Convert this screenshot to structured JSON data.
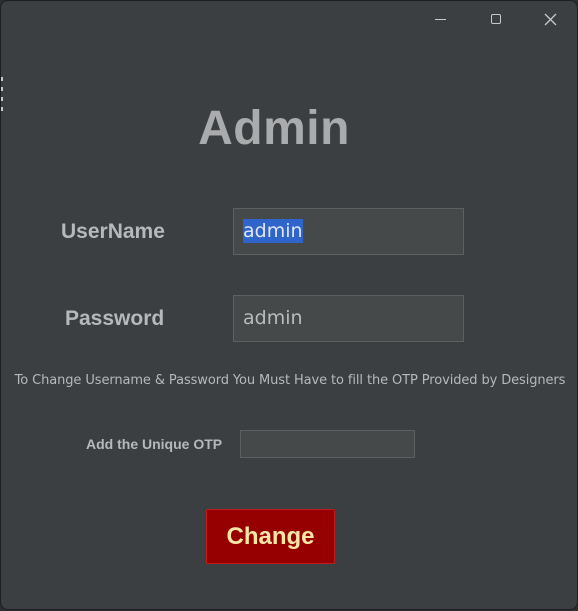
{
  "window": {
    "controls": {
      "minimize": "minimize-icon",
      "maximize": "maximize-icon",
      "close": "close-icon"
    }
  },
  "form": {
    "title": "Admin",
    "username_label": "UserName",
    "username_value": "admin",
    "password_label": "Password",
    "password_value": "admin",
    "notice": "To Change Username & Password You Must Have to fill the OTP Provided by Designers",
    "otp_label": "Add the Unique OTP",
    "otp_value": "",
    "change_label": "Change"
  },
  "colors": {
    "background": "#3c3f41",
    "field": "#45494a",
    "button": "#960000",
    "button_text": "#f6e7a6",
    "selection": "#2f65ca"
  }
}
